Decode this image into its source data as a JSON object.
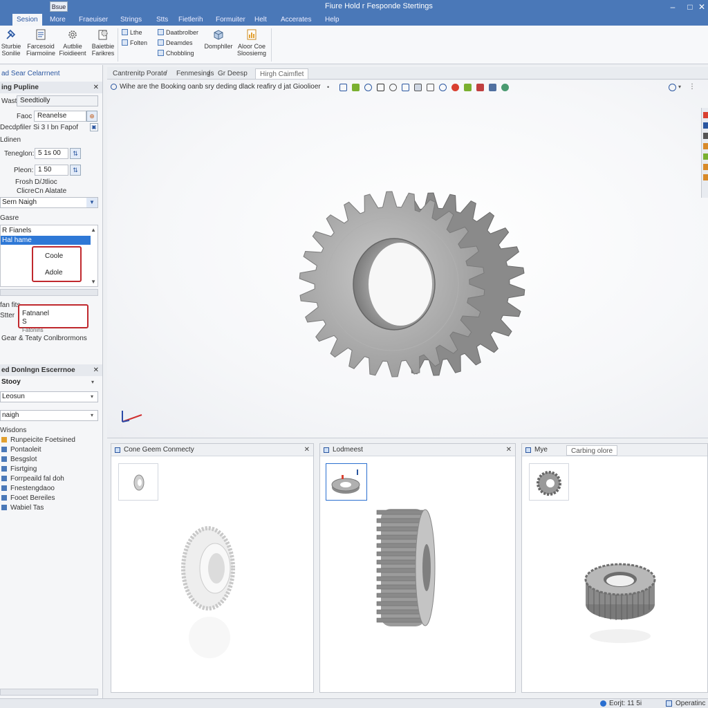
{
  "titlebar": {
    "quick_access": "Bsue",
    "title": "Fiure Hold r Fesponde Stertings",
    "minimize": "–",
    "maximize": "□",
    "close": "✕"
  },
  "menu": [
    "Sesion",
    "More",
    "Fraeuiser",
    "Strings",
    "Stts",
    "Fietlerih",
    "Formuiter",
    "Helt",
    "Accerates",
    "Help"
  ],
  "ribbon": {
    "large_buttons": [
      {
        "label1": "Sturbie",
        "label2": "Sonilie",
        "icon": "tools-icon"
      },
      {
        "label1": "Farcesoid",
        "label2": "Fiarmoiine",
        "icon": "document-icon"
      },
      {
        "label1": "Autblie",
        "label2": "Fioidieent",
        "icon": "gear-icon"
      },
      {
        "label1": "Baietbie",
        "label2": "Farikres",
        "icon": "gear-doc-icon"
      }
    ],
    "small_col1": [
      "Lthe",
      "Folten"
    ],
    "small_col2": [
      "Daatbrolber",
      "Deamdes",
      "Chobbling"
    ],
    "right_buttons": [
      {
        "label1": "Domphller",
        "label2": "",
        "icon": "box-icon"
      },
      {
        "label1": "Aloor Coe",
        "label2": "Sloosiemg",
        "icon": "chart-doc-icon"
      }
    ]
  },
  "left_panel": {
    "header_link": "ad Sear Celarrnent",
    "section1_title": "ing Pupline",
    "want_label": "Wast",
    "want_value": "Seedtiolly",
    "face_label": "Faoc",
    "face_value": "Reanelse",
    "desc_label": "Decdpfiler",
    "desc_value": "Si 3 I bn Fapof",
    "options_label": "Ldinen",
    "teeth_label": "Teneglon:",
    "teeth_value": "5 1s 00",
    "pitch_label": "Pleon:",
    "pitch_value": "1 50",
    "frosh_label": "Frosh",
    "frosh_value": "D/Jtlioc",
    "close_label": "Clicre",
    "close_value": "Cn Alatate",
    "dropdown_value": "Sern Naigh",
    "gears_label": "Gasre",
    "list_header": "R Fianels",
    "list_selected": "Hal hame",
    "popup_items": [
      "Coole",
      "Adole"
    ],
    "unfits_label": "fan fits",
    "extra_label": "Stter",
    "popup2_line1": "Fatnanel",
    "popup2_line2": "S",
    "popup2_below": "Fatonins",
    "gears_config": "Gear & Teaty Conlbrormons",
    "section2_title": "ed Donlngn Escerrnoe",
    "body_dd": "Stooy",
    "model_dd": "Leosun",
    "insight_dd": "naigh",
    "wisdom_label": "Wisdons",
    "tree": [
      "Runpeicite Foetsined",
      "Pontaoleit",
      "Besgslot",
      "Fisrtging",
      "Forrpeaild fal doh",
      "Fnestengdaoo",
      "Fooet Bereiles",
      "Wabiel Tas"
    ]
  },
  "viewport": {
    "breadcrumbs": [
      "Cantrenitp Porate",
      "/",
      "Fenmesings",
      "/",
      "Gr Deesp",
      "Hirgh Caimflet"
    ],
    "hint": "Wihe are the Booking oanb sry deding dlack reafiry d jat Gioolioer"
  },
  "panes": [
    {
      "title": "Cone Geem Conmecty"
    },
    {
      "title": "Lodmeest"
    },
    {
      "title": "Mye",
      "tab": "Carbing olore"
    }
  ],
  "status": {
    "left": "Eorjt: 11 5i",
    "right": "Operatinc"
  }
}
